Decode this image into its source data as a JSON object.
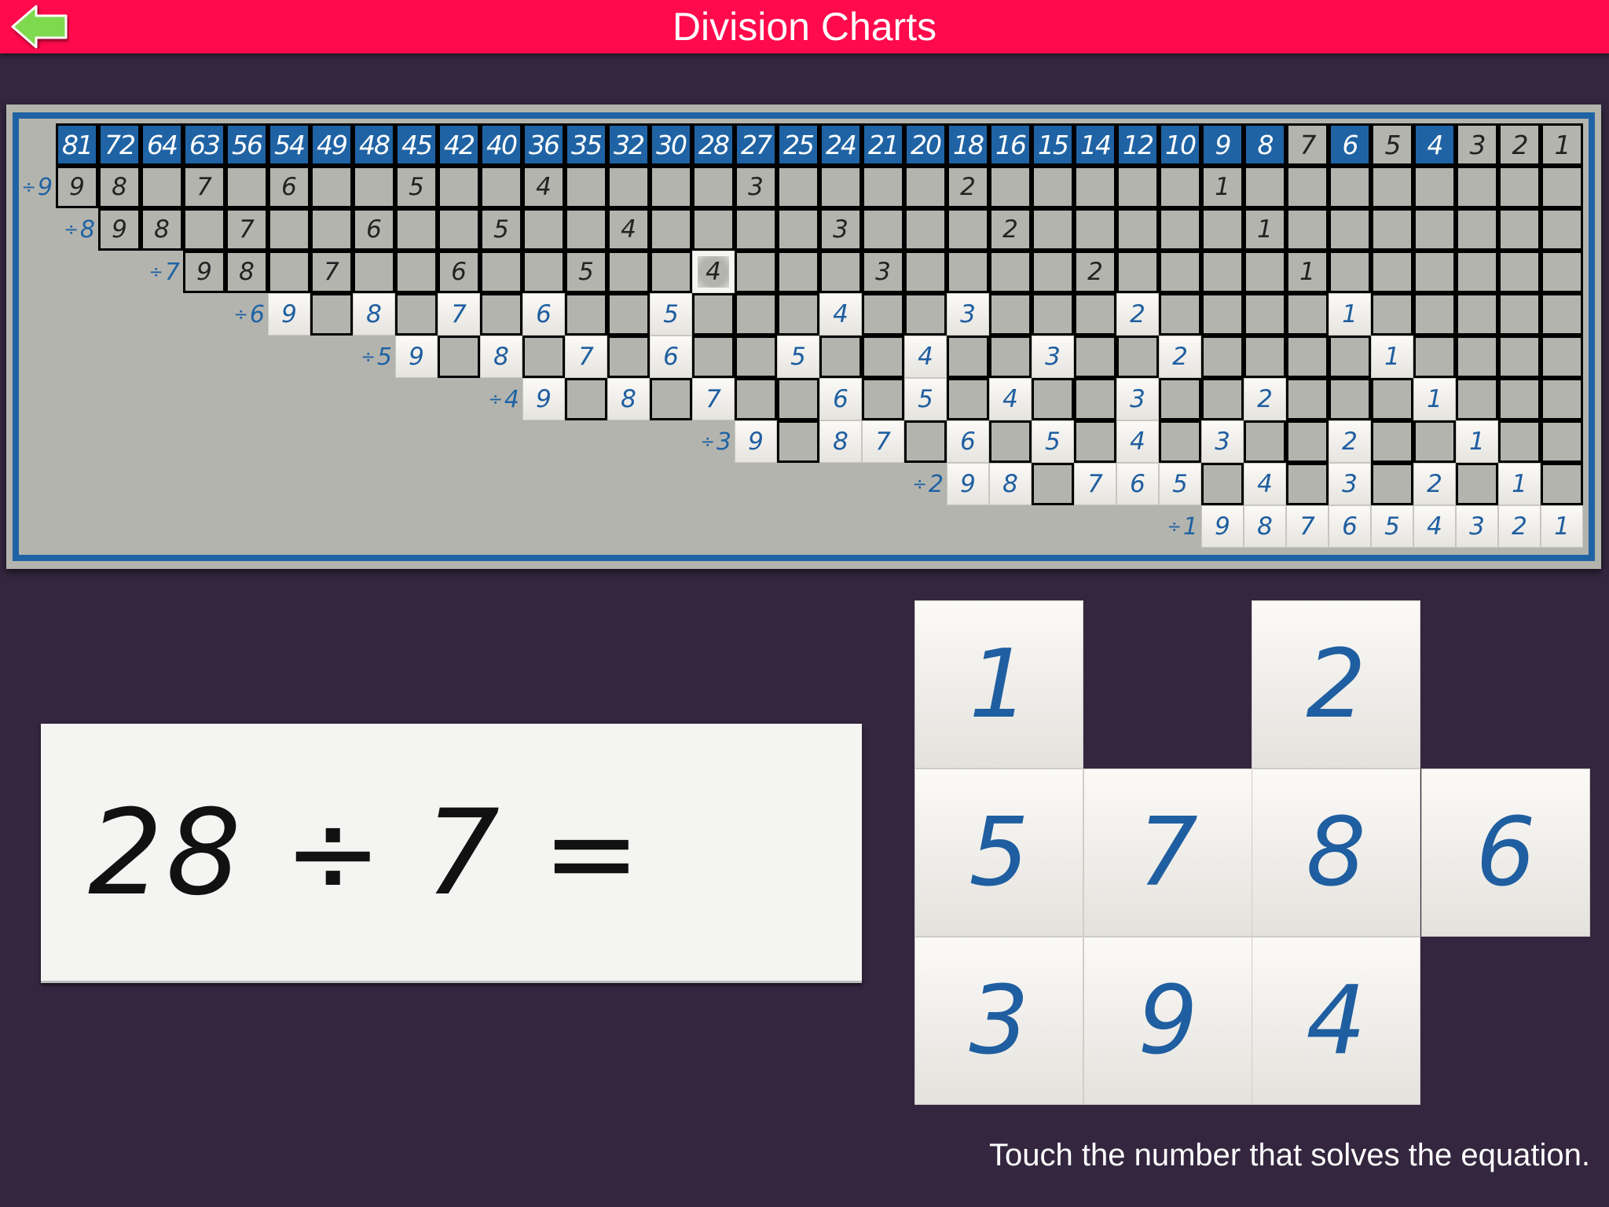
{
  "header": {
    "title": "Division Charts",
    "back_icon": "back-arrow-icon",
    "back_color": "#7fd94e",
    "bar_color": "#ff0a4c"
  },
  "chart": {
    "dividends": [
      "81",
      "72",
      "64",
      "63",
      "56",
      "54",
      "49",
      "48",
      "45",
      "42",
      "40",
      "36",
      "35",
      "32",
      "30",
      "28",
      "27",
      "25",
      "24",
      "21",
      "20",
      "18",
      "16",
      "15",
      "14",
      "12",
      "10",
      "9",
      "8",
      "7",
      "6",
      "5",
      "4",
      "3",
      "2",
      "1"
    ],
    "header_gray": [
      "7",
      "5",
      "3",
      "2",
      "1"
    ],
    "highlight": {
      "divisor": 7,
      "dividend": 28
    },
    "rows": [
      {
        "label": "÷9",
        "divisor": 9,
        "start": 0,
        "revealed": false
      },
      {
        "label": "÷8",
        "divisor": 8,
        "start": 1,
        "revealed": false
      },
      {
        "label": "÷7",
        "divisor": 7,
        "start": 3,
        "revealed": false
      },
      {
        "label": "÷6",
        "divisor": 6,
        "start": 5,
        "revealed": true
      },
      {
        "label": "÷5",
        "divisor": 5,
        "start": 8,
        "revealed": true
      },
      {
        "label": "÷4",
        "divisor": 4,
        "start": 11,
        "revealed": true
      },
      {
        "label": "÷3",
        "divisor": 3,
        "start": 16,
        "revealed": true
      },
      {
        "label": "÷2",
        "divisor": 2,
        "start": 21,
        "revealed": true
      },
      {
        "label": "÷1",
        "divisor": 1,
        "start": 27,
        "revealed": true
      }
    ],
    "colors": {
      "blue": "#1f63a4",
      "gray": "#b4b4ae",
      "digit_blue": "#1f5ea0"
    }
  },
  "equation": {
    "dividend": "28",
    "operator": "÷",
    "divisor": "7",
    "equals": "="
  },
  "answer_tiles": [
    {
      "value": "1",
      "row": 0,
      "col": 0
    },
    {
      "value": "2",
      "row": 0,
      "col": 2
    },
    {
      "value": "5",
      "row": 1,
      "col": 0
    },
    {
      "value": "7",
      "row": 1,
      "col": 1
    },
    {
      "value": "8",
      "row": 1,
      "col": 2
    },
    {
      "value": "6",
      "row": 1,
      "col": 3
    },
    {
      "value": "3",
      "row": 2,
      "col": 0
    },
    {
      "value": "9",
      "row": 2,
      "col": 1
    },
    {
      "value": "4",
      "row": 2,
      "col": 2
    }
  ],
  "instruction": "Touch the number that solves the equation."
}
